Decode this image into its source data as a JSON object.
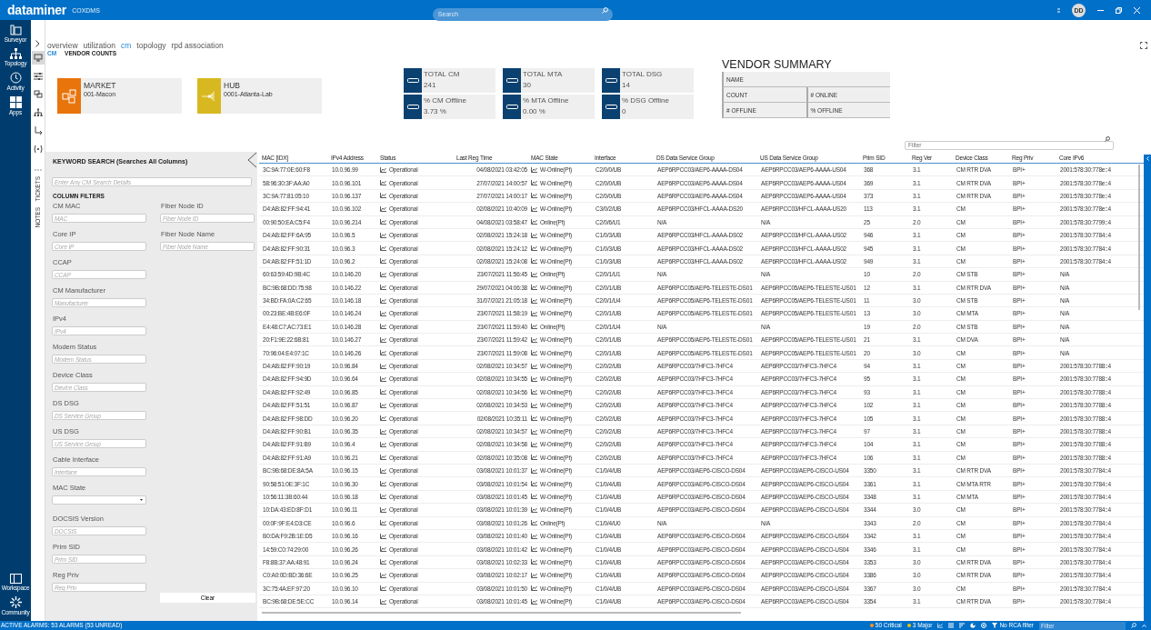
{
  "header": {
    "brand": "dataminer",
    "system": "COXDMS",
    "search": {
      "placeholder": "Search"
    },
    "user_initials": "DD"
  },
  "nav_top": [
    {
      "label": "Surveyor",
      "kind": "surveyor"
    },
    {
      "label": "Topology",
      "kind": "topology"
    },
    {
      "label": "Activity",
      "kind": "activity"
    },
    {
      "label": "Apps",
      "kind": "apps"
    }
  ],
  "nav_bottom": [
    {
      "label": "Workspace",
      "kind": "workspace"
    },
    {
      "label": "Community",
      "kind": "community"
    }
  ],
  "side_tools": [
    {
      "kind": "monitor",
      "selected": true
    },
    {
      "kind": "sliders",
      "selected": false
    },
    {
      "kind": "layers",
      "selected": false
    },
    {
      "kind": "hierarchy",
      "selected": false
    },
    {
      "kind": "connector",
      "selected": false
    },
    {
      "kind": "signal",
      "selected": false
    }
  ],
  "side_tabs": [
    {
      "label": "TICKETS"
    },
    {
      "label": "NOTES"
    }
  ],
  "tabs": [
    {
      "label": "overview",
      "selected": false
    },
    {
      "label": "utilization",
      "selected": false
    },
    {
      "label": "cm",
      "selected": true
    },
    {
      "label": "topology",
      "selected": false
    },
    {
      "label": "rpd association",
      "selected": false
    }
  ],
  "breadcrumb": [
    "CM",
    "VENDOR COUNTS"
  ],
  "locations": [
    {
      "kind": "market",
      "title": "MARKET",
      "value": "001-Macon",
      "color": "#e8740c"
    },
    {
      "kind": "hub",
      "title": "HUB",
      "value": "0001-Atlanta-Lab",
      "color": "#d8b820"
    }
  ],
  "kpis": [
    {
      "label": "TOTAL CM",
      "value": "241"
    },
    {
      "label": "% CM Offline",
      "value": "3.73 %"
    },
    {
      "label": "TOTAL MTA",
      "value": "30"
    },
    {
      "label": "% MTA Offline",
      "value": "0.00 %"
    },
    {
      "label": "TOTAL DSG",
      "value": "14"
    },
    {
      "label": "% DSG Offline",
      "value": "0"
    }
  ],
  "vendor_summary": {
    "title": "VENDOR SUMMARY",
    "rows": [
      [
        "NAME"
      ],
      [
        "COUNT",
        "# ONLINE"
      ],
      [
        "# OFFLINE",
        "% OFFLINE"
      ]
    ]
  },
  "table_filter": {
    "placeholder": "Filter"
  },
  "keyword_search": {
    "title": "KEYWORD SEARCH (Searches All Columns)",
    "placeholder": "Enter Any CM Search Details"
  },
  "column_filters": {
    "title": "COLUMN FILTERS",
    "left": [
      {
        "label": "CM MAC",
        "kind": "text",
        "placeholder": "MAC"
      },
      {
        "label": "Core IP",
        "kind": "text",
        "placeholder": "Core IP"
      },
      {
        "label": "CCAP",
        "kind": "text",
        "placeholder": "CCAP"
      },
      {
        "label": "CM Manufacturer",
        "kind": "text",
        "placeholder": "Manufacturer"
      },
      {
        "label": "IPv4",
        "kind": "text",
        "placeholder": "IPv4"
      },
      {
        "label": "Modem Status",
        "kind": "text",
        "placeholder": "Modem Status"
      },
      {
        "label": "Device Class",
        "kind": "text",
        "placeholder": "Device Class"
      },
      {
        "label": "DS DSG",
        "kind": "text",
        "placeholder": "DS Service Group"
      },
      {
        "label": "US DSG",
        "kind": "text",
        "placeholder": "US Service Group"
      },
      {
        "label": "Cable Interface",
        "kind": "text",
        "placeholder": "Interface"
      },
      {
        "label": "MAC State",
        "kind": "select"
      },
      {
        "label": "DOCSIS Version",
        "kind": "text",
        "placeholder": "DOCSIS"
      },
      {
        "label": "Prim SID",
        "kind": "text",
        "placeholder": "Prim SID"
      },
      {
        "label": "Reg Priv",
        "kind": "text",
        "placeholder": "Reg Priv"
      }
    ],
    "right": [
      {
        "label": "Fiber Node ID",
        "kind": "text",
        "placeholder": "Fiber Node ID"
      },
      {
        "label": "Fiber Node Name",
        "kind": "text",
        "placeholder": "Fiber Node Name"
      }
    ],
    "clear": "Clear"
  },
  "table": {
    "columns": [
      {
        "label": "MAC [IDX]",
        "kind": "text"
      },
      {
        "label": "IPv4 Address",
        "kind": "text"
      },
      {
        "label": "Status",
        "kind": "trend"
      },
      {
        "label": "Last Reg Time",
        "kind": "time"
      },
      {
        "label": "MAC State",
        "kind": "trend"
      },
      {
        "label": "Interface",
        "kind": "text"
      },
      {
        "label": "DS Data Service Group",
        "kind": "text"
      },
      {
        "label": "US Data Service Group",
        "kind": "text"
      },
      {
        "label": "Prim SID",
        "kind": "text"
      },
      {
        "label": "Reg Ver",
        "kind": "text"
      },
      {
        "label": "Device Class",
        "kind": "text"
      },
      {
        "label": "Reg Priv",
        "kind": "text"
      },
      {
        "label": "Core IPv6",
        "kind": "text"
      }
    ],
    "rows": [
      [
        "3C:9A:77:0E:60:F8",
        "10.0.96.99",
        "Operational",
        "04/08/2021 03:42:05",
        "W-Online(Pt)",
        "C2/0/0/UB",
        "AEP6RPCC03/AEP6-AAAA-DS04",
        "AEP6RPCC03/AEP6-AAAA-US04",
        "368",
        "3.1",
        "CM RTR DVA",
        "BPI+",
        "2001:578:30:778e::4"
      ],
      [
        "58:96:30:3F:AA:A0",
        "10.0.96.101",
        "Operational",
        "27/07/2021 14:00:57",
        "W-Online(Pt)",
        "C2/0/0/UB",
        "AEP6RPCC03/AEP6-AAAA-DS04",
        "AEP6RPCC03/AEP6-AAAA-US04",
        "369",
        "3.1",
        "CM RTR DVA",
        "BPI+",
        "2001:578:30:778e::4"
      ],
      [
        "3C:9A:77:81:05:10",
        "10.0.96.137",
        "Operational",
        "27/07/2021 14:00:17",
        "W-Online(Pt)",
        "C2/0/0/UB",
        "AEP6RPCC03/AEP6-AAAA-DS04",
        "AEP6RPCC03/AEP6-AAAA-US04",
        "373",
        "3.1",
        "CM RTR DVA",
        "BPI+",
        "2001:578:30:778e::4"
      ],
      [
        "D4:AB:82:FF:94:41",
        "10.0.96.102",
        "Operational",
        "02/08/2021 10:40:09",
        "W-Online(Pt)",
        "C3/0/2/UB",
        "AEP6RPCC03/HFCL-AAAA-DS20",
        "AEP6RPCC03/HFCL-AAAA-US20",
        "113",
        "3.1",
        "CM",
        "BPI+",
        "2001:578:30:778e::4"
      ],
      [
        "00:90:50:EA:C5:F4",
        "10.0.96.214",
        "Operational",
        "04/08/2021 03:58:47",
        "Online(Pt)",
        "C2/0/6/U1",
        "N/A",
        "N/A",
        "25",
        "2.0",
        "CM",
        "BPI+",
        "2001:578:30:7799::4"
      ],
      [
        "D4:AB:82:FF:6A:95",
        "10.0.96.5",
        "Operational",
        "02/08/2021 15:24:18",
        "W-Online(Pt)",
        "C1/0/3/UB",
        "AEP6RPCC03/HFCL-AAAA-DS02",
        "AEP6RPCC03/HFCL-AAAA-US02",
        "946",
        "3.1",
        "CM",
        "BPI+",
        "2001:578:30:7784::4"
      ],
      [
        "D4:AB:82:FF:90:31",
        "10.0.96.3",
        "Operational",
        "02/08/2021 15:24:12",
        "W-Online(Pt)",
        "C1/0/3/UB",
        "AEP6RPCC03/HFCL-AAAA-DS02",
        "AEP6RPCC03/HFCL-AAAA-US02",
        "945",
        "3.1",
        "CM",
        "BPI+",
        "2001:578:30:7784::4"
      ],
      [
        "D4:AB:82:FF:51:1D",
        "10.0.96.2",
        "Operational",
        "02/08/2021 15:24:08",
        "W-Online(Pt)",
        "C1/0/3/UB",
        "AEP6RPCC03/HFCL-AAAA-DS02",
        "AEP6RPCC03/HFCL-AAAA-US02",
        "949",
        "3.1",
        "CM",
        "BPI+",
        "2001:578:30:7784::4"
      ],
      [
        "60:63:59:4D:9B:4C",
        "10.0.146.20",
        "Operational",
        "23/07/2021 11:56:45",
        "Online(Pt)",
        "C2/0/1/U1",
        "N/A",
        "N/A",
        "10",
        "2.0",
        "CM STB",
        "BPI+",
        "N/A"
      ],
      [
        "BC:9B:68:DD:75:98",
        "10.0.146.22",
        "Operational",
        "29/07/2021 04:06:38",
        "W-Online(Pt)",
        "C2/0/1/UB",
        "AEP6RPCC05/AEP6-TELESTE-DS01",
        "AEP6RPCC05/AEP6-TELESTE-US01",
        "12",
        "3.1",
        "CM RTR DVA",
        "BPI+",
        "N/A"
      ],
      [
        "34:BD:FA:0A:C2:65",
        "10.0.146.18",
        "Operational",
        "31/07/2021 21:05:18",
        "W-Online(Pt)",
        "C2/0/1/U4",
        "AEP6RPCC05/AEP6-TELESTE-DS01",
        "AEP6RPCC05/AEP6-TELESTE-US01",
        "11",
        "3.0",
        "CM STB",
        "BPI+",
        "N/A"
      ],
      [
        "00:23:BE:4B:E6:0F",
        "10.0.146.24",
        "Operational",
        "23/07/2021 11:58:19",
        "W-Online(Pt)",
        "C2/0/1/UB",
        "AEP6RPCC05/AEP6-TELESTE-DS01",
        "AEP6RPCC05/AEP6-TELESTE-US01",
        "13",
        "3.0",
        "CM MTA",
        "BPI+",
        "N/A"
      ],
      [
        "E4:48:C7:AC:73:E1",
        "10.0.146.28",
        "Operational",
        "23/07/2021 11:59:40",
        "Online(Pt)",
        "C2/0/1/U4",
        "N/A",
        "N/A",
        "19",
        "2.0",
        "CM STB",
        "BPI+",
        "N/A"
      ],
      [
        "20:F1:9E:22:6B:81",
        "10.0.146.27",
        "Operational",
        "23/07/2021 11:59:42",
        "W-Online(Pt)",
        "C2/0/1/UB",
        "AEP6RPCC05/AEP6-TELESTE-DS01",
        "AEP6RPCC05/AEP6-TELESTE-US01",
        "21",
        "3.1",
        "CM DVA",
        "BPI+",
        "N/A"
      ],
      [
        "70:96:04:E4:07:1C",
        "10.0.146.26",
        "Operational",
        "23/07/2021 11:59:08",
        "W-Online(Pt)",
        "C2/0/1/UB",
        "AEP6RPCC05/AEP6-TELESTE-DS01",
        "AEP6RPCC05/AEP6-TELESTE-US01",
        "20",
        "3.0",
        "CM",
        "BPI+",
        "N/A"
      ],
      [
        "D4:AB:82:FF:90:19",
        "10.0.96.84",
        "Operational",
        "02/08/2021 10:34:57",
        "W-Online(Pt)",
        "C2/0/2/UB",
        "AEP6RPCC03/7HFC3-7HFC4",
        "AEP6RPCC03/7HFC3-7HFC4",
        "94",
        "3.1",
        "CM",
        "BPI+",
        "2001:578:30:7788::4"
      ],
      [
        "D4:AB:82:FF:94:9D",
        "10.0.96.64",
        "Operational",
        "02/08/2021 10:34:55",
        "W-Online(Pt)",
        "C2/0/2/UB",
        "AEP6RPCC03/7HFC3-7HFC4",
        "AEP6RPCC03/7HFC3-7HFC4",
        "95",
        "3.1",
        "CM",
        "BPI+",
        "2001:578:30:7788::4"
      ],
      [
        "D4:AB:82:FF:92:49",
        "10.0.96.85",
        "Operational",
        "02/08/2021 10:34:56",
        "W-Online(Pt)",
        "C2/0/2/UB",
        "AEP6RPCC03/7HFC3-7HFC4",
        "AEP6RPCC03/7HFC3-7HFC4",
        "93",
        "3.1",
        "CM",
        "BPI+",
        "2001:578:30:7788::4"
      ],
      [
        "D4:AB:82:FF:51:51",
        "10.0.96.87",
        "Operational",
        "02/08/2021 10:34:53",
        "W-Online(Pt)",
        "C2/0/2/UB",
        "AEP6RPCC03/7HFC3-7HFC4",
        "AEP6RPCC03/7HFC3-7HFC4",
        "102",
        "3.1",
        "CM",
        "BPI+",
        "2001:578:30:7788::4"
      ],
      [
        "D4:AB:82:FF:98:DD",
        "10.0.96.20",
        "Operational",
        "02/08/2021 10:35:11",
        "W-Online(Pt)",
        "C2/0/2/UB",
        "AEP6RPCC03/7HFC3-7HFC4",
        "AEP6RPCC03/7HFC3-7HFC4",
        "105",
        "3.1",
        "CM",
        "BPI+",
        "2001:578:30:7788::4"
      ],
      [
        "D4:AB:82:FF:90:B1",
        "10.0.96.35",
        "Operational",
        "02/08/2021 10:34:57",
        "W-Online(Pt)",
        "C2/0/2/UB",
        "AEP6RPCC03/7HFC3-7HFC4",
        "AEP6RPCC03/7HFC3-7HFC4",
        "97",
        "3.1",
        "CM",
        "BPI+",
        "2001:578:30:7788::4"
      ],
      [
        "D4:AB:82:FF:91:B9",
        "10.0.96.4",
        "Operational",
        "02/08/2021 10:34:58",
        "W-Online(Pt)",
        "C2/0/2/UB",
        "AEP6RPCC03/7HFC3-7HFC4",
        "AEP6RPCC03/7HFC3-7HFC4",
        "104",
        "3.1",
        "CM",
        "BPI+",
        "2001:578:30:7788::4"
      ],
      [
        "D4:AB:82:FF:91:A9",
        "10.0.96.21",
        "Operational",
        "02/08/2021 10:35:08",
        "W-Online(Pt)",
        "C2/0/2/UB",
        "AEP6RPCC03/7HFC3-7HFC4",
        "AEP6RPCC03/7HFC3-7HFC4",
        "106",
        "3.1",
        "CM",
        "BPI+",
        "2001:578:30:7788::4"
      ],
      [
        "BC:9B:68:DE:8A:5A",
        "10.0.96.15",
        "Operational",
        "03/08/2021 10:01:37",
        "W-Online(Pt)",
        "C1/0/4/UB",
        "AEP6RPCC03/AEP6-CISCO-DS04",
        "AEP6RPCC03/AEP6-CISCO-US04",
        "3350",
        "3.1",
        "CM RTR DVA",
        "BPI+",
        "2001:578:30:7784::4"
      ],
      [
        "90:58:51:0E:3F:1C",
        "10.0.96.30",
        "Operational",
        "03/08/2021 10:01:54",
        "W-Online(Pt)",
        "C1/0/4/UB",
        "AEP6RPCC03/AEP6-CISCO-DS04",
        "AEP6RPCC03/AEP6-CISCO-US04",
        "3361",
        "3.1",
        "CM MTA RTR",
        "BPI+",
        "2001:578:30:7784::4"
      ],
      [
        "10:56:11:3B:60:44",
        "10.0.96.18",
        "Operational",
        "03/08/2021 10:01:45",
        "W-Online(Pt)",
        "C1/0/4/UB",
        "AEP6RPCC03/AEP6-CISCO-DS04",
        "AEP6RPCC03/AEP6-CISCO-US04",
        "3348",
        "3.1",
        "CM MTA",
        "BPI+",
        "2001:578:30:7784::4"
      ],
      [
        "10:DA:43:ED:8F:D1",
        "10.0.96.11",
        "Operational",
        "03/08/2021 10:01:39",
        "W-Online(Pt)",
        "C1/0/4/UB",
        "AEP6RPCC03/AEP6-CISCO-DS04",
        "AEP6RPCC03/AEP6-CISCO-US04",
        "3344",
        "3.0",
        "CM",
        "BPI+",
        "2001:578:30:7784::4"
      ],
      [
        "00:0F:9F:E4:D3:CE",
        "10.0.96.6",
        "Operational",
        "03/08/2021 10:01:26",
        "Online(Pt)",
        "C1/0/4/U0",
        "N/A",
        "N/A",
        "3343",
        "2.0",
        "CM",
        "BPI+",
        "2001:578:30:7784::4"
      ],
      [
        "B0:DA:F9:2B:1E:D5",
        "10.0.96.16",
        "Operational",
        "03/08/2021 10:01:40",
        "W-Online(Pt)",
        "C1/0/4/UB",
        "AEP6RPCC03/AEP6-CISCO-DS04",
        "AEP6RPCC03/AEP6-CISCO-US04",
        "3342",
        "3.1",
        "CM",
        "BPI+",
        "2001:578:30:7784::4"
      ],
      [
        "14:59:C0:74:29:00",
        "10.0.96.26",
        "Operational",
        "03/08/2021 10:01:42",
        "W-Online(Pt)",
        "C1/0/4/UB",
        "AEP6RPCC03/AEP6-CISCO-DS04",
        "AEP6RPCC03/AEP6-CISCO-US04",
        "3346",
        "3.1",
        "CM",
        "BPI+",
        "2001:578:30:7784::4"
      ],
      [
        "F8:8B:37:AA:48:91",
        "10.0.96.24",
        "Operational",
        "03/08/2021 10:02:33",
        "W-Online(Pt)",
        "C1/0/4/UB",
        "AEP6RPCC03/AEP6-CISCO-DS04",
        "AEP6RPCC03/AEP6-CISCO-US04",
        "3353",
        "3.0",
        "CM RTR DVA",
        "BPI+",
        "2001:578:30:7784::4"
      ],
      [
        "C0:A0:0D:BD:36:6E",
        "10.0.96.25",
        "Operational",
        "03/08/2021 10:02:17",
        "W-Online(Pt)",
        "C1/0/4/UB",
        "AEP6RPCC03/AEP6-CISCO-DS04",
        "AEP6RPCC03/AEP6-CISCO-US04",
        "3386",
        "3.0",
        "CM RTR DVA",
        "BPI+",
        "2001:578:30:7784::4"
      ],
      [
        "3C:75:4A:EF:97:20",
        "10.0.96.10",
        "Operational",
        "03/08/2021 10:01:50",
        "W-Online(Pt)",
        "C1/0/4/UB",
        "AEP6RPCC03/AEP6-CISCO-DS04",
        "AEP6RPCC03/AEP6-CISCO-US04",
        "3367",
        "3.0",
        "CM",
        "BPI+",
        "2001:578:30:7784::4"
      ],
      [
        "BC:9B:68:DE:5E:CC",
        "10.0.96.14",
        "Operational",
        "03/08/2021 10:01:45",
        "W-Online(Pt)",
        "C1/0/4/UB",
        "AEP6RPCC03/AEP6-CISCO-DS04",
        "AEP6RPCC03/AEP6-CISCO-US04",
        "3354",
        "3.1",
        "CM RTR DVA",
        "BPI+",
        "2001:578:30:7784::4"
      ]
    ]
  },
  "status_bar": {
    "alarms": "ACTIVE ALARMS: 53 ALARMS (53 UNREAD)",
    "counters": [
      {
        "label": "50 Critical",
        "color": "#f7941d"
      },
      {
        "label": "3 Major",
        "color": "#f2c200"
      }
    ],
    "rca": "No RCA filter",
    "filter": {
      "placeholder": "Filter"
    }
  }
}
